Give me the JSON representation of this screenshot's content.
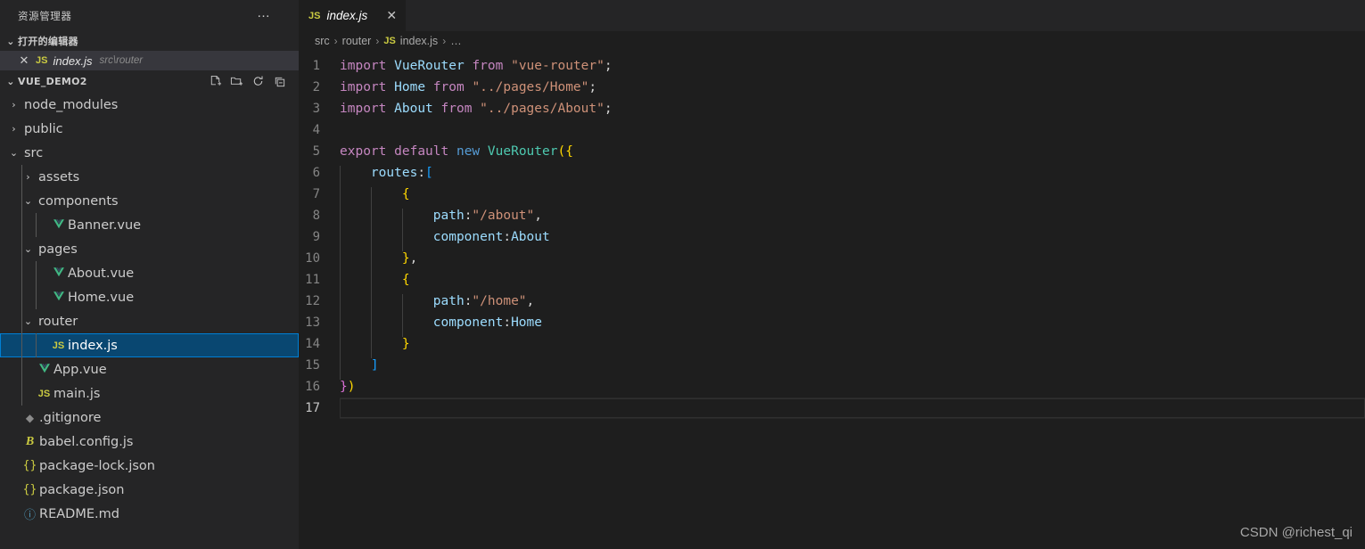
{
  "sidebar": {
    "title": "资源管理器",
    "ellipsis": "…",
    "open_editors": {
      "header_label": "打开的编辑器",
      "chevron": "⌄",
      "items": [
        {
          "close": "✕",
          "icon": "JS",
          "name": "index.js",
          "path": "src\\router"
        }
      ]
    },
    "project": {
      "header_label": "VUE_DEMO2",
      "chevron": "⌄",
      "actions": [
        {
          "name": "new-file-icon"
        },
        {
          "name": "new-folder-icon"
        },
        {
          "name": "refresh-icon"
        },
        {
          "name": "collapse-all-icon"
        }
      ]
    },
    "tree": [
      {
        "label": "node_modules",
        "type": "folder",
        "twisty": "›",
        "indent": 0,
        "open": false,
        "selected": false
      },
      {
        "label": "public",
        "type": "folder",
        "twisty": "›",
        "indent": 0,
        "open": false,
        "selected": false
      },
      {
        "label": "src",
        "type": "folder",
        "twisty": "⌄",
        "indent": 0,
        "open": true,
        "selected": false
      },
      {
        "label": "assets",
        "type": "folder",
        "twisty": "›",
        "indent": 1,
        "open": false,
        "selected": false
      },
      {
        "label": "components",
        "type": "folder",
        "twisty": "⌄",
        "indent": 1,
        "open": true,
        "selected": false
      },
      {
        "label": "Banner.vue",
        "type": "vue",
        "twisty": "",
        "indent": 2,
        "open": false,
        "selected": false
      },
      {
        "label": "pages",
        "type": "folder",
        "twisty": "⌄",
        "indent": 1,
        "open": true,
        "selected": false
      },
      {
        "label": "About.vue",
        "type": "vue",
        "twisty": "",
        "indent": 2,
        "open": false,
        "selected": false
      },
      {
        "label": "Home.vue",
        "type": "vue",
        "twisty": "",
        "indent": 2,
        "open": false,
        "selected": false
      },
      {
        "label": "router",
        "type": "folder",
        "twisty": "⌄",
        "indent": 1,
        "open": true,
        "selected": false
      },
      {
        "label": "index.js",
        "type": "js",
        "twisty": "",
        "indent": 2,
        "open": false,
        "selected": true
      },
      {
        "label": "App.vue",
        "type": "vue",
        "twisty": "",
        "indent": 1,
        "open": false,
        "selected": false
      },
      {
        "label": "main.js",
        "type": "js",
        "twisty": "",
        "indent": 1,
        "open": false,
        "selected": false
      },
      {
        "label": ".gitignore",
        "type": "git",
        "twisty": "",
        "indent": 0,
        "open": false,
        "selected": false
      },
      {
        "label": "babel.config.js",
        "type": "babel",
        "twisty": "",
        "indent": 0,
        "open": false,
        "selected": false
      },
      {
        "label": "package-lock.json",
        "type": "json",
        "twisty": "",
        "indent": 0,
        "open": false,
        "selected": false
      },
      {
        "label": "package.json",
        "type": "json",
        "twisty": "",
        "indent": 0,
        "open": false,
        "selected": false
      },
      {
        "label": "README.md",
        "type": "md",
        "twisty": "",
        "indent": 0,
        "open": false,
        "selected": false
      }
    ]
  },
  "editor": {
    "tabs": [
      {
        "icon": "JS",
        "name": "index.js",
        "close": "✕",
        "active": true
      }
    ],
    "breadcrumb": [
      {
        "text": "src",
        "icon": ""
      },
      {
        "text": "router",
        "icon": ""
      },
      {
        "text": "index.js",
        "icon": "JS"
      },
      {
        "text": "…",
        "icon": ""
      }
    ],
    "breadcrumb_separator": "›",
    "active_line": 17,
    "lines": [
      {
        "n": 1,
        "text": "import VueRouter from \"vue-router\";"
      },
      {
        "n": 2,
        "text": "import Home from \"../pages/Home\";"
      },
      {
        "n": 3,
        "text": "import About from \"../pages/About\";"
      },
      {
        "n": 4,
        "text": ""
      },
      {
        "n": 5,
        "text": "export default new VueRouter({"
      },
      {
        "n": 6,
        "text": "    routes:["
      },
      {
        "n": 7,
        "text": "        {"
      },
      {
        "n": 8,
        "text": "            path:\"/about\","
      },
      {
        "n": 9,
        "text": "            component:About"
      },
      {
        "n": 10,
        "text": "        },"
      },
      {
        "n": 11,
        "text": "        {"
      },
      {
        "n": 12,
        "text": "            path:\"/home\","
      },
      {
        "n": 13,
        "text": "            component:Home"
      },
      {
        "n": 14,
        "text": "        }"
      },
      {
        "n": 15,
        "text": "    ]"
      },
      {
        "n": 16,
        "text": "})"
      },
      {
        "n": 17,
        "text": ""
      }
    ]
  },
  "watermark": "CSDN @richest_qi",
  "colors": {
    "sidebar_bg": "#252526",
    "editor_bg": "#1e1e1e",
    "selection_bg": "#094771",
    "selection_border": "#007fd4",
    "open_editor_bg": "#37373d",
    "keyword": "#c586c0",
    "keyword_blue": "#569cd6",
    "identifier": "#9cdcfe",
    "class": "#4ec9b0",
    "string": "#ce9178",
    "bracket_yellow": "#ffd700",
    "bracket_magenta": "#da70d6",
    "bracket_blue": "#179fff",
    "line_number": "#858585"
  }
}
